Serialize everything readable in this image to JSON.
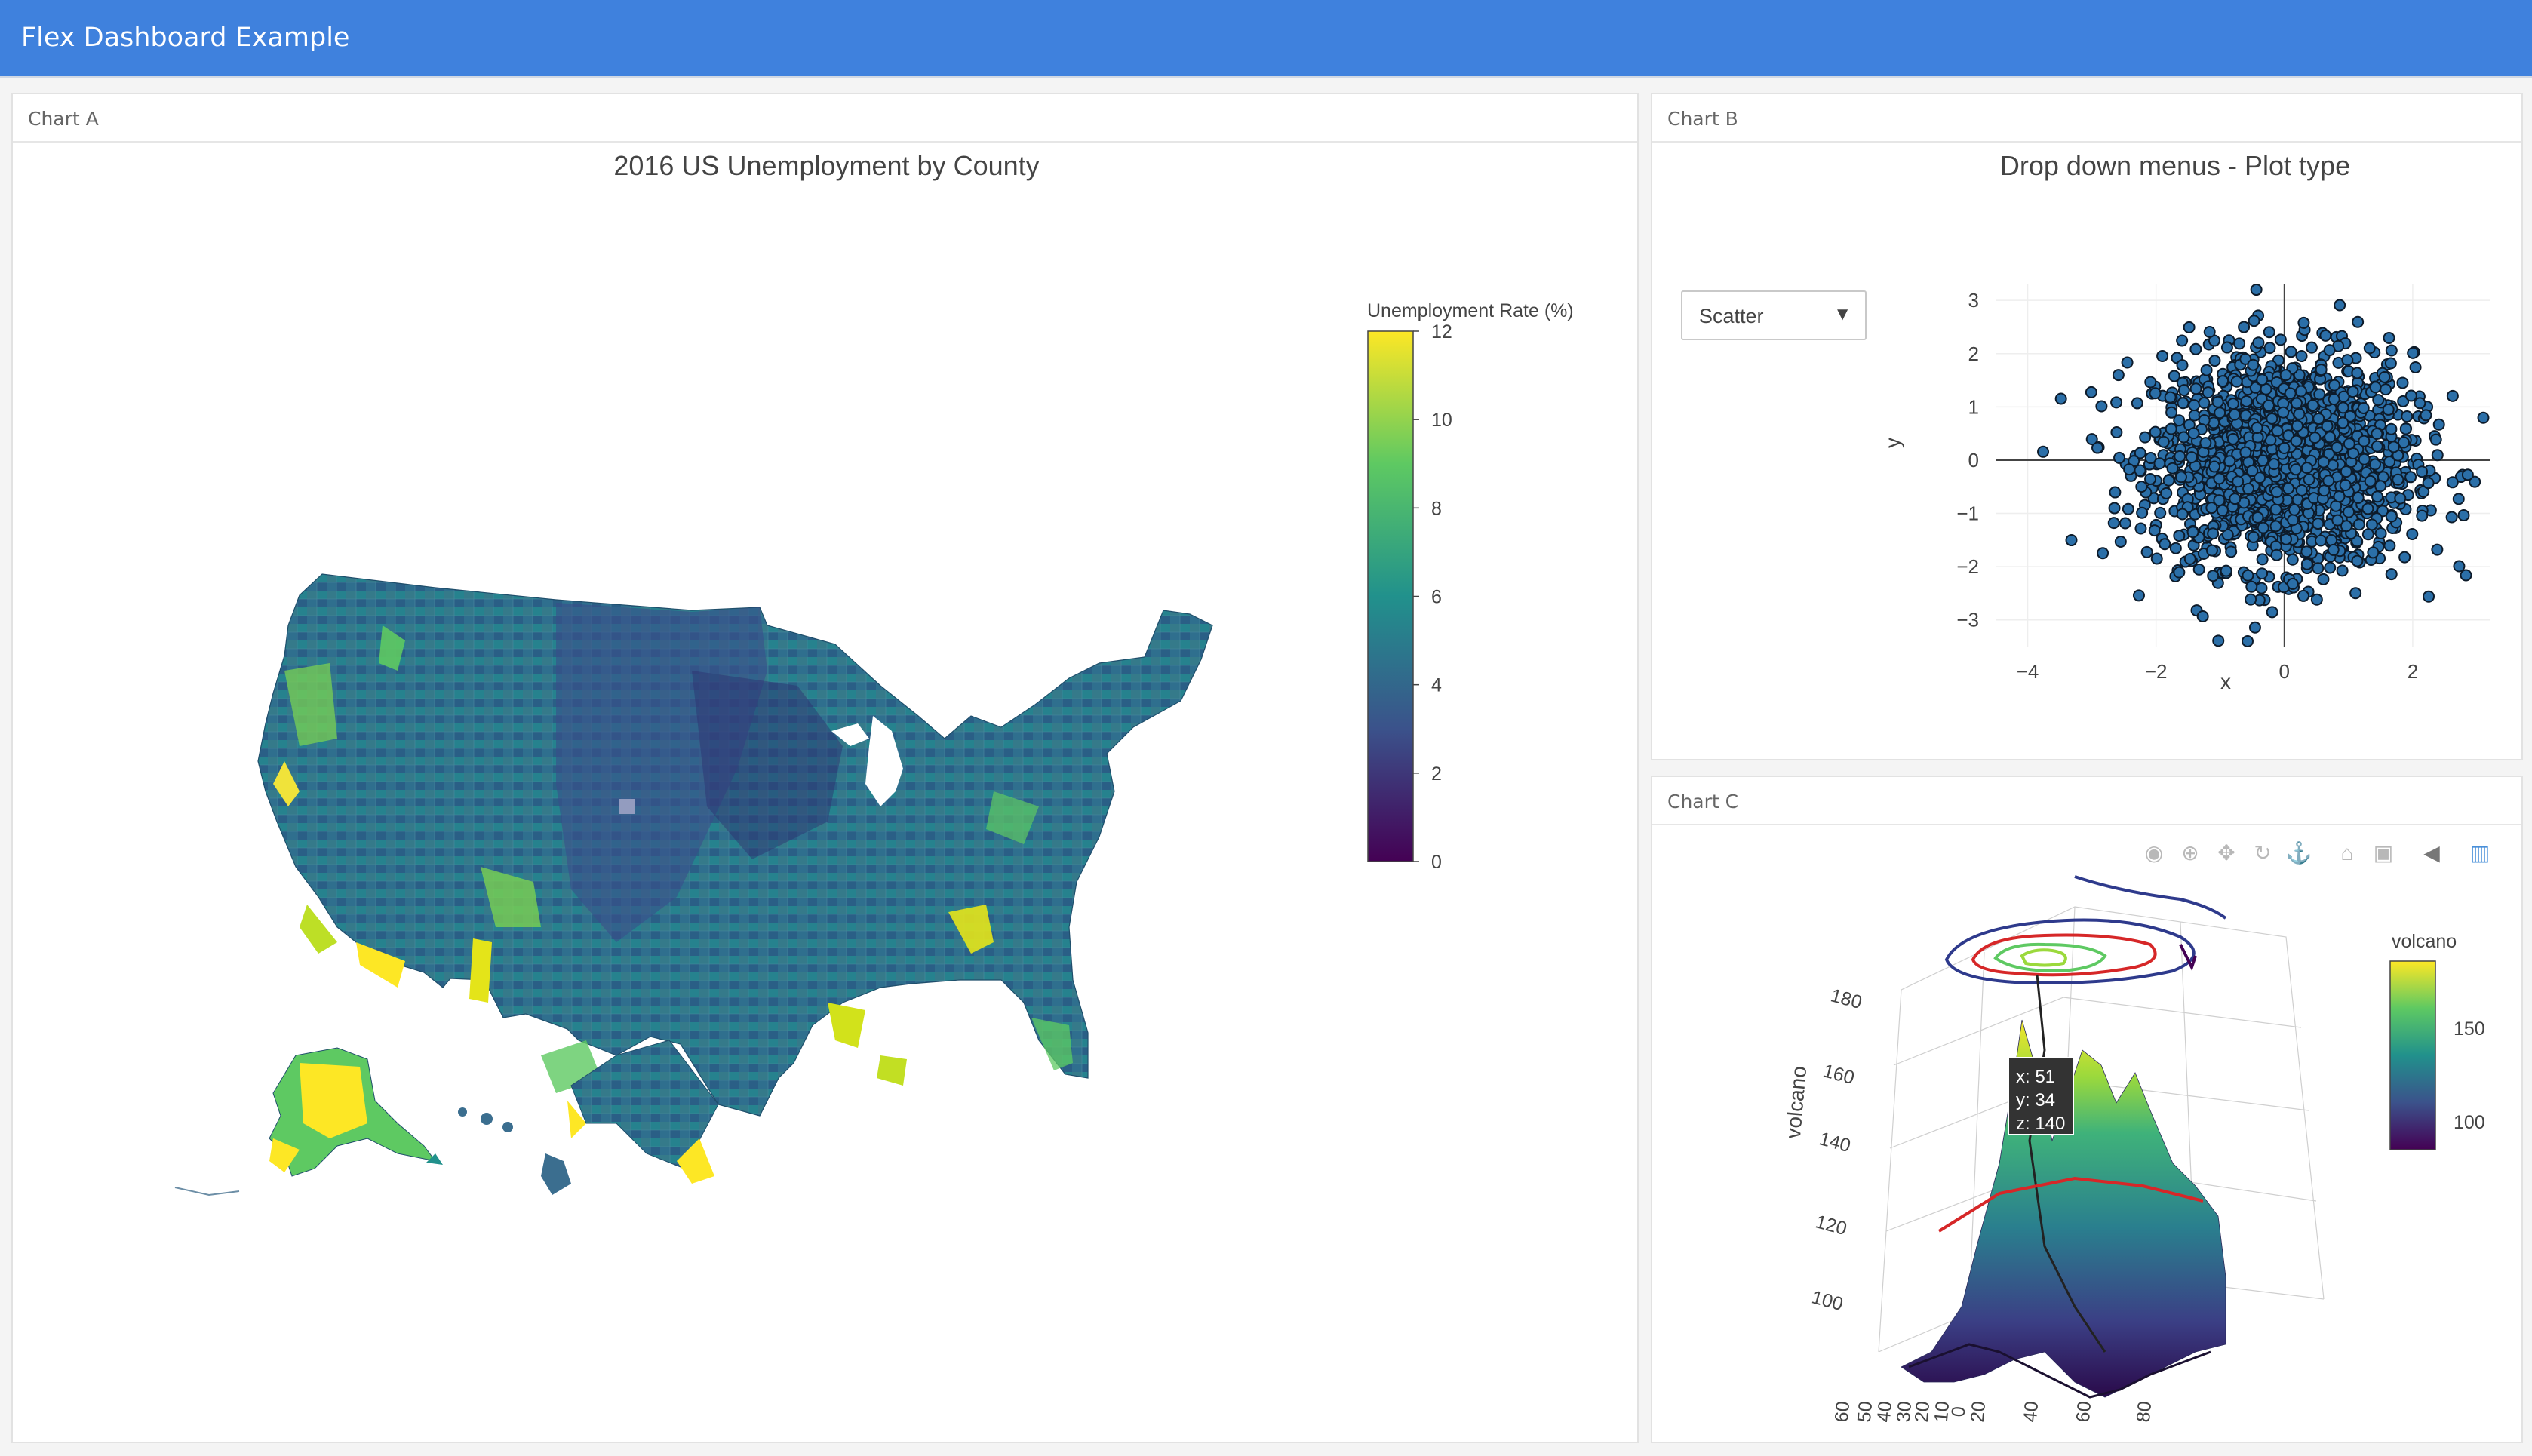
{
  "app": {
    "title": "Flex Dashboard Example",
    "accent_color": "#3f81dd"
  },
  "panels": {
    "a": {
      "label": "Chart A"
    },
    "b": {
      "label": "Chart B"
    },
    "c": {
      "label": "Chart C"
    }
  },
  "chart_a": {
    "title": "2016 US Unemployment by County",
    "colorbar_title": "Unemployment Rate (%)",
    "colorbar_ticks": [
      "12",
      "10",
      "8",
      "6",
      "4",
      "2",
      "0"
    ],
    "colorscale": [
      "#440154",
      "#3b528b",
      "#21918c",
      "#5ec962",
      "#fde725"
    ]
  },
  "chart_b": {
    "title": "Drop down menus - Plot type",
    "dropdown_selected": "Scatter",
    "dropdown_arrow": "▼",
    "xlabel": "x",
    "ylabel": "y",
    "xticks": [
      "−4",
      "−2",
      "0",
      "2"
    ],
    "yticks": [
      "3",
      "2",
      "1",
      "0",
      "−1",
      "−2",
      "−3"
    ]
  },
  "chart_c": {
    "colorbar_title": "volcano",
    "colorbar_ticks": [
      "150",
      "100"
    ],
    "zlabel": "volcano",
    "zticks": [
      "180",
      "160",
      "140",
      "120",
      "100"
    ],
    "xticks": [
      "60",
      "50",
      "40",
      "30",
      "20",
      "10",
      "0",
      "20",
      "40",
      "60",
      "80"
    ],
    "tooltip": [
      "x: 51",
      "y: 34",
      "z: 140"
    ],
    "modebar_icons": [
      "camera-icon",
      "zoom-icon",
      "pan-icon",
      "orbit-rotate-icon",
      "turntable-icon",
      "reset-home-icon",
      "camera-view-icon",
      "hover-toggle-icon",
      "plotly-logo-icon"
    ]
  },
  "chart_data": [
    {
      "type": "heatmap",
      "title": "2016 US Unemployment by County",
      "colorbar_label": "Unemployment Rate (%)",
      "range": [
        0,
        12
      ]
    },
    {
      "type": "scatter",
      "title": "Drop down menus - Plot type",
      "xlabel": "x",
      "ylabel": "y",
      "xlim": [
        -4.5,
        3.2
      ],
      "ylim": [
        -3.5,
        3.3
      ],
      "distribution": "bivariate normal, mean (0,0), sd 1",
      "grid": true
    },
    {
      "type": "surface",
      "zlabel": "volcano",
      "zlim": [
        94,
        195
      ],
      "colorbar_label": "volcano",
      "tooltip_point": {
        "x": 51,
        "y": 34,
        "z": 140
      }
    }
  ]
}
